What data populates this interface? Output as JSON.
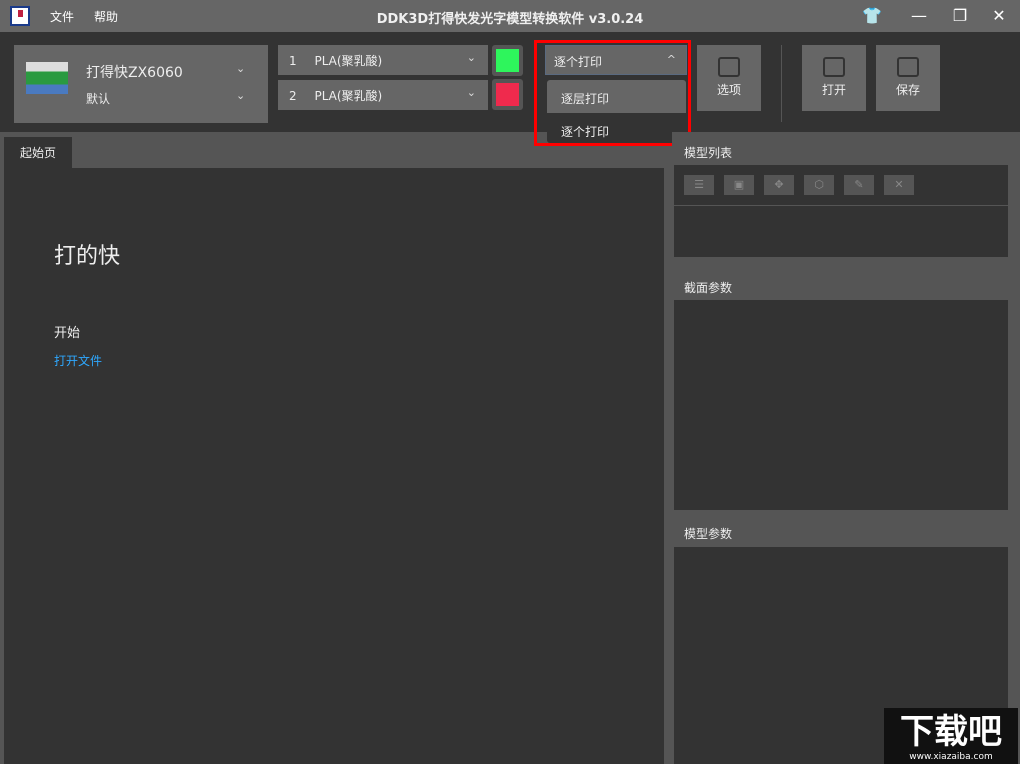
{
  "titlebar": {
    "menu": [
      "文件",
      "帮助"
    ],
    "title": "DDK3D打得快发光字模型转换软件 v3.0.24"
  },
  "printer": {
    "name": "打得快ZX6060",
    "profile": "默认"
  },
  "materials": [
    {
      "index": "1",
      "name": "PLA(聚乳酸)",
      "color": "#2ef55c"
    },
    {
      "index": "2",
      "name": "PLA(聚乳酸)",
      "color": "#ef2a4d"
    }
  ],
  "print_mode": {
    "selected": "逐个打印",
    "options": [
      "逐层打印",
      "逐个打印"
    ]
  },
  "toolbar": {
    "options_label": "选项",
    "open_label": "打开",
    "save_label": "保存"
  },
  "tabs": [
    "起始页"
  ],
  "start_page": {
    "heading": "打的快",
    "section": "开始",
    "open_file_link": "打开文件"
  },
  "right_panel": {
    "model_list": "模型列表",
    "slice_params": "截面参数",
    "model_params": "模型参数"
  },
  "watermark": {
    "text": "下载吧",
    "url": "www.xiazaiba.com"
  }
}
